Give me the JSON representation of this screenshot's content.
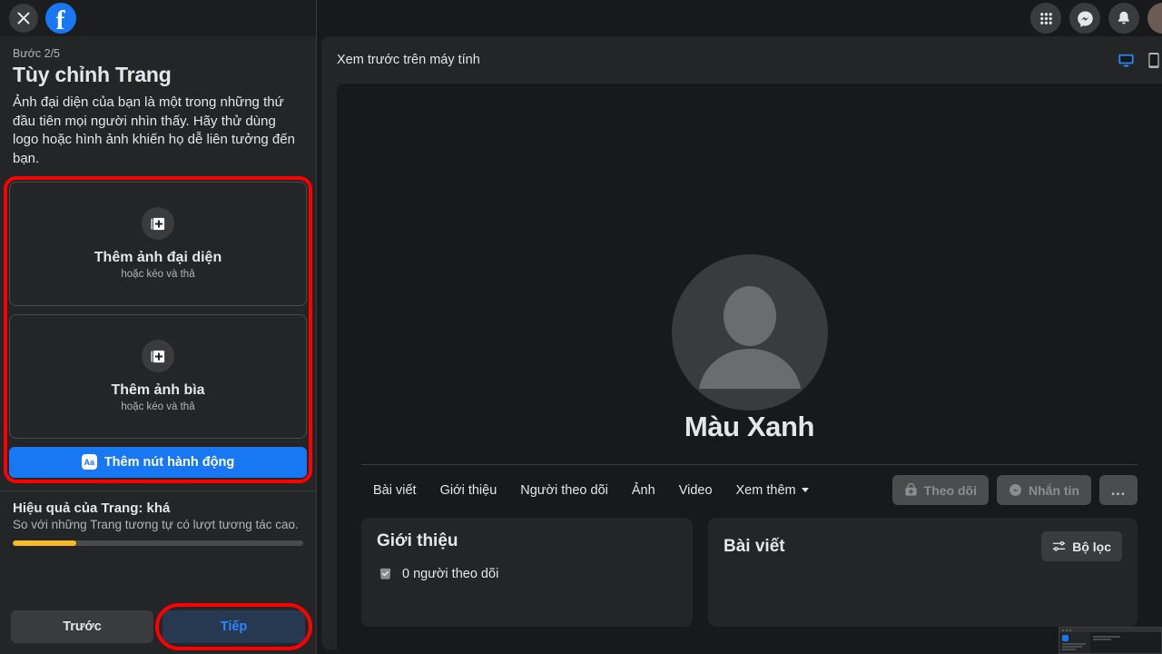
{
  "sidebar": {
    "close_icon": "close-icon",
    "brand_logo": "facebook-logo",
    "brand_letter": "f",
    "step_label": "Bước 2/5",
    "title": "Tùy chỉnh Trang",
    "description": "Ảnh đại diện của bạn là một trong những thứ đầu tiên mọi người nhìn thấy. Hãy thử dùng logo hoặc hình ảnh khiến họ dễ liên tưởng đến bạn.",
    "upload_cards": [
      {
        "title": "Thêm ảnh đại diện",
        "subtitle": "hoặc kéo và thả",
        "icon": "add-photo-icon"
      },
      {
        "title": "Thêm ảnh bìa",
        "subtitle": "hoặc kéo và thả",
        "icon": "add-photo-icon"
      }
    ],
    "action_button": {
      "label": "Thêm nút hành động",
      "icon_text": "Aa",
      "color": "#1877f2"
    },
    "quality": {
      "title": "Hiệu quả của Trang: khá",
      "subtitle": "So với những Trang tương tự có lượt tương tác cao.",
      "progress_percent": 22,
      "progress_color": "#f7b928"
    },
    "footer": {
      "prev_label": "Trước",
      "next_label": "Tiếp",
      "next_text_color": "#2d88ff"
    },
    "annotation_color": "#ff0000"
  },
  "topbar": {
    "icons": [
      {
        "name": "apps-grid-icon"
      },
      {
        "name": "messenger-icon"
      },
      {
        "name": "notifications-bell-icon"
      }
    ],
    "avatar": "user-avatar"
  },
  "preview": {
    "header_title": "Xem trước trên máy tính",
    "device_icons": [
      {
        "name": "desktop-preview-icon",
        "active": true,
        "color": "#2d88ff"
      },
      {
        "name": "mobile-preview-icon",
        "active": false,
        "color": "#b0b3b8"
      }
    ],
    "page": {
      "name": "Màu Xanh",
      "avatar": "default-profile-avatar",
      "tabs": [
        {
          "label": "Bài viết"
        },
        {
          "label": "Giới thiệu"
        },
        {
          "label": "Người theo dõi"
        },
        {
          "label": "Ảnh"
        },
        {
          "label": "Video"
        },
        {
          "label": "Xem thêm"
        }
      ],
      "actions": [
        {
          "label": "Theo dõi",
          "icon": "follow-person-icon",
          "disabled": true
        },
        {
          "label": "Nhắn tin",
          "icon": "messenger-icon",
          "disabled": true
        },
        {
          "label": "…",
          "icon": "more-options-icon",
          "disabled": false
        }
      ],
      "intro_card": {
        "heading": "Giới thiệu",
        "follower_text": "0 người theo dõi",
        "follower_icon": "verified-badge-icon"
      },
      "posts_card": {
        "heading": "Bài viết",
        "filter_label": "Bộ lọc",
        "filter_icon": "filter-sliders-icon"
      }
    }
  }
}
